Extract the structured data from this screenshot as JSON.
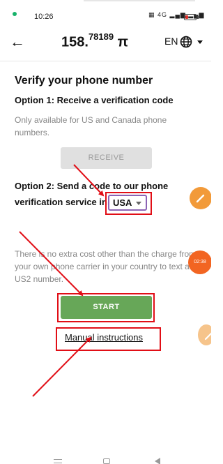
{
  "status_bar": {
    "time": "10:26",
    "signal_text": "4G",
    "battery_color": "#e0302b"
  },
  "header": {
    "balance_main": "158.",
    "balance_decimals": "78189",
    "currency_symbol": "π",
    "language": "EN",
    "back_icon": "back-arrow-icon",
    "globe_icon": "globe-icon",
    "caret_icon": "chevron-down-icon"
  },
  "page": {
    "title": "Verify your phone number"
  },
  "option1": {
    "heading": "Option 1: Receive a verification code",
    "description": "Only available for US and Canada phone numbers.",
    "button_label": "RECEIVE"
  },
  "option2": {
    "heading_line1": "Option 2: Send a code to our phone",
    "heading_line2": "verification service in",
    "country_value": "USA",
    "description": "There is no extra cost other than the charge from your own phone carrier in your country to text a US2 number.",
    "button_label": "START",
    "manual_link": "Manual instructions"
  },
  "overlay": {
    "timer_label": "02:38"
  },
  "colors": {
    "accent_green": "#67a758",
    "disabled_gray": "#e0e0e0",
    "annotation_red": "#e10e16",
    "select_border": "#8b63b5",
    "float_orange": "#f29a39",
    "float_timer": "#f26522"
  }
}
